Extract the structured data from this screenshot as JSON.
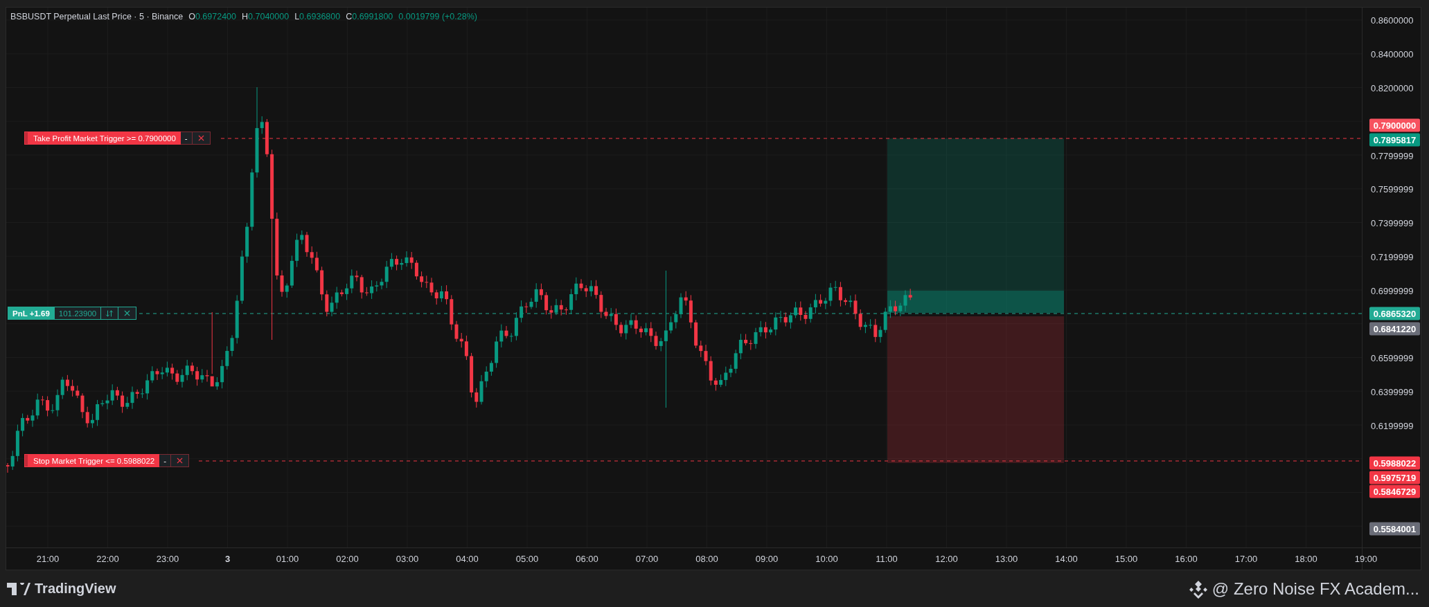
{
  "legend": {
    "symbol": "BSBUSDT Perpetual Last Price · 5 · Binance",
    "ohlc": [
      {
        "label": "O",
        "value": "0.6972400"
      },
      {
        "label": "H",
        "value": "0.7040000"
      },
      {
        "label": "L",
        "value": "0.6936800"
      },
      {
        "label": "C",
        "value": "0.6991800"
      }
    ],
    "change": "0.0019799 (+0.28%)"
  },
  "orders": [
    {
      "kind": "take_profit",
      "label": "Take Profit Market Trigger >= 0.7900000",
      "minus": "-"
    },
    {
      "kind": "stop",
      "label": "Stop Market Trigger <= 0.5988022",
      "minus": "-"
    }
  ],
  "position": {
    "pnl": "PnL +1.69",
    "quantity": "101.23900"
  },
  "price_axis": {
    "ticks": [
      "0.8600000",
      "0.8400000",
      "0.8200000",
      "0.7799999",
      "0.7599999",
      "0.7399999",
      "0.7199999",
      "0.6999999",
      "0.6599999",
      "0.6399999",
      "0.6199999"
    ],
    "tags": [
      {
        "text": "0.7900000",
        "color": "#f7525f"
      },
      {
        "text": "0.7895817",
        "color": "#089981"
      },
      {
        "text": "0.6865320",
        "color": "#22ab94"
      },
      {
        "text": "0.6841220",
        "color": "#6a6d78"
      },
      {
        "text": "0.5988022",
        "color": "#f23645"
      },
      {
        "text": "0.5975719",
        "color": "#f23645"
      },
      {
        "text": "0.5846729",
        "color": "#f23645"
      },
      {
        "text": "0.5584001",
        "color": "#6a6d78"
      }
    ]
  },
  "time_axis": [
    {
      "text": "21:00",
      "kind": "hour"
    },
    {
      "text": "22:00",
      "kind": "hour"
    },
    {
      "text": "23:00",
      "kind": "hour"
    },
    {
      "text": "3",
      "kind": "day"
    },
    {
      "text": "01:00",
      "kind": "hour"
    },
    {
      "text": "02:00",
      "kind": "hour"
    },
    {
      "text": "03:00",
      "kind": "hour"
    },
    {
      "text": "04:00",
      "kind": "hour"
    },
    {
      "text": "05:00",
      "kind": "hour"
    },
    {
      "text": "06:00",
      "kind": "hour"
    },
    {
      "text": "07:00",
      "kind": "hour"
    },
    {
      "text": "08:00",
      "kind": "hour"
    },
    {
      "text": "09:00",
      "kind": "hour"
    },
    {
      "text": "10:00",
      "kind": "hour"
    },
    {
      "text": "11:00",
      "kind": "hour"
    },
    {
      "text": "12:00",
      "kind": "hour"
    },
    {
      "text": "13:00",
      "kind": "hour"
    },
    {
      "text": "14:00",
      "kind": "hour"
    },
    {
      "text": "15:00",
      "kind": "hour"
    },
    {
      "text": "16:00",
      "kind": "hour"
    },
    {
      "text": "17:00",
      "kind": "hour"
    },
    {
      "text": "18:00",
      "kind": "hour"
    },
    {
      "text": "19:00",
      "kind": "hour"
    }
  ],
  "footer": {
    "logo": "TradingView",
    "author": "@ Zero Noise FX Academ..."
  }
}
